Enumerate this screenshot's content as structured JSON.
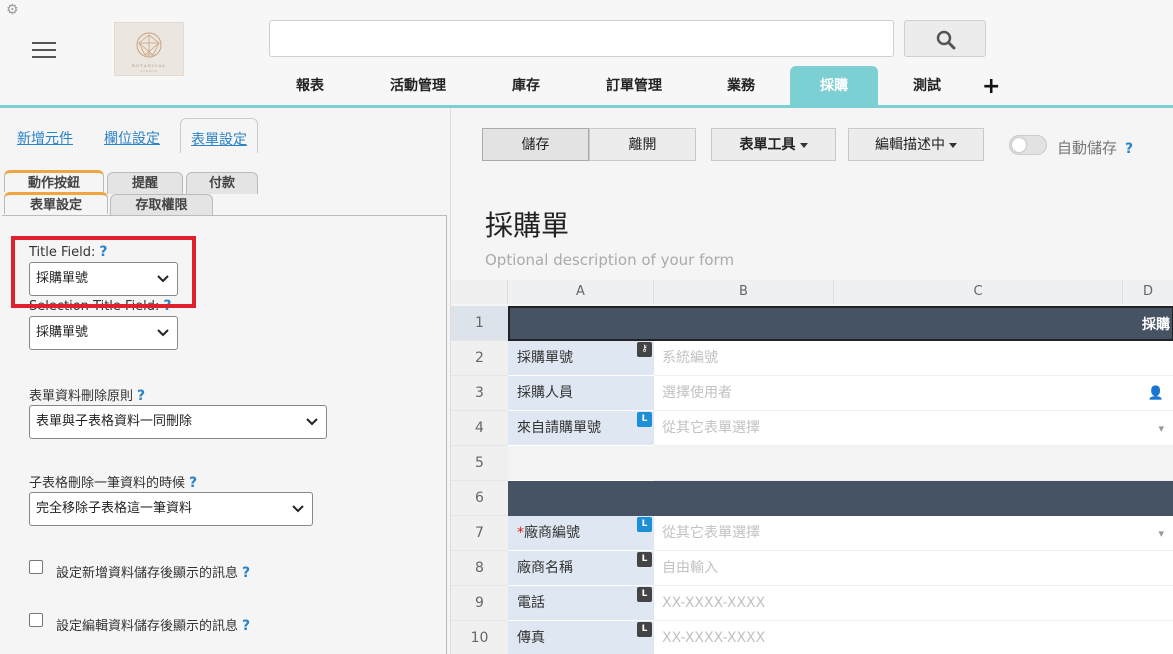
{
  "header": {
    "search_placeholder": "",
    "nav": [
      {
        "label": "報表"
      },
      {
        "label": "活動管理"
      },
      {
        "label": "庫存"
      },
      {
        "label": "訂單管理"
      },
      {
        "label": "業務"
      },
      {
        "label": "採購",
        "active": true
      },
      {
        "label": "測試"
      }
    ],
    "add_label": "+",
    "logo_text": "BOTANICAL",
    "logo_sub": "STUDIO"
  },
  "left_panel": {
    "tabs": [
      {
        "label": "新增元件"
      },
      {
        "label": "欄位設定"
      },
      {
        "label": "表單設定",
        "active": true
      }
    ],
    "sub_tabs_row1": [
      {
        "label": "動作按鈕",
        "active": true
      },
      {
        "label": "提醒"
      },
      {
        "label": "付款"
      }
    ],
    "sub_tabs_row2": [
      {
        "label": "表單設定",
        "active": true
      },
      {
        "label": "存取權限"
      }
    ],
    "title_field": {
      "label": "Title Field:",
      "help": "?",
      "value": "採購單號"
    },
    "selection_title_field": {
      "label": "Selection Title Field:",
      "help": "?",
      "value": "採購單號"
    },
    "delete_rule": {
      "label": "表單資料刪除原則",
      "help": "?",
      "value": "表單與子表格資料一同刪除"
    },
    "subtable_delete": {
      "label": "子表格刪除一筆資料的時候",
      "help": "?",
      "value": "完全移除子表格這一筆資料"
    },
    "checkbox_new_msg": {
      "label": "設定新增資料儲存後顯示的訊息",
      "help": "?",
      "checked": false
    },
    "checkbox_edit_msg": {
      "label": "設定編輯資料儲存後顯示的訊息",
      "help": "?",
      "checked": false
    }
  },
  "right_panel": {
    "toolbar": {
      "save": "儲存",
      "leave": "離開",
      "form_tools": "表單工具",
      "edit_mode": "編輯描述中",
      "autosave": "自動儲存",
      "help": "?"
    },
    "form_title": "採購單",
    "form_description": "Optional description of your form",
    "columns": [
      "A",
      "B",
      "C",
      "D"
    ],
    "rows": [
      {
        "num": "1",
        "type": "section",
        "text": "採購"
      },
      {
        "num": "2",
        "label": "採購單號",
        "value": "系統編號",
        "badge": "key",
        "req": false
      },
      {
        "num": "3",
        "label": "採購人員",
        "value": "選擇使用者",
        "icon": "user",
        "req": false
      },
      {
        "num": "4",
        "label": "來自請購單號",
        "value": "從其它表單選擇",
        "badge": "L",
        "badge_color": "blue",
        "icon": "dropdown",
        "req": false
      },
      {
        "num": "5",
        "type": "empty"
      },
      {
        "num": "6",
        "type": "section",
        "text": ""
      },
      {
        "num": "7",
        "label": "廠商編號",
        "value": "從其它表單選擇",
        "badge": "L",
        "badge_color": "blue",
        "icon": "dropdown",
        "req": true
      },
      {
        "num": "8",
        "label": "廠商名稱",
        "value": "自由輸入",
        "badge": "L",
        "badge_color": "dark",
        "req": false
      },
      {
        "num": "9",
        "label": "電話",
        "value": "XX-XXXX-XXXX",
        "badge": "L",
        "badge_color": "dark",
        "req": false
      },
      {
        "num": "10",
        "label": "傳真",
        "value": "XX-XXXX-XXXX",
        "badge": "L",
        "badge_color": "dark",
        "req": false
      }
    ]
  }
}
